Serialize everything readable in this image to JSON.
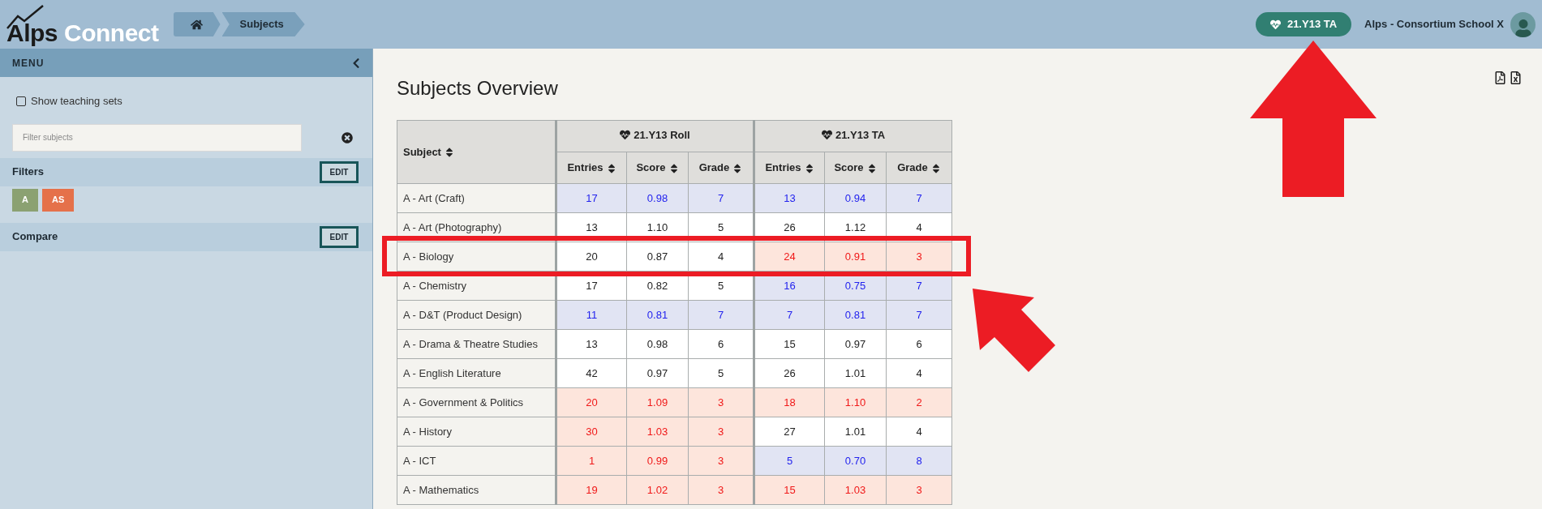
{
  "header": {
    "logo": [
      "Alps",
      "Connect"
    ],
    "breadcrumb": [
      {
        "label": "Subjects"
      }
    ],
    "dataset_badge": "21.Y13 TA",
    "school": "Alps - Consortium School X"
  },
  "sidebar": {
    "title": "MENU",
    "show_teaching_sets": {
      "label": "Show teaching sets",
      "checked": false
    },
    "search": {
      "placeholder": "Filter subjects"
    },
    "sections": [
      {
        "title": "Filters",
        "button": "EDIT",
        "tags": [
          {
            "label": "A",
            "color": "#8ba172"
          },
          {
            "label": "AS",
            "color": "#e5714a"
          }
        ]
      },
      {
        "title": "Compare",
        "button": "EDIT"
      }
    ]
  },
  "main": {
    "title": "Subjects Overview",
    "table": {
      "subject_heading": "Subject",
      "groups": [
        {
          "title": "21.Y13 Roll",
          "columns": [
            "Entries",
            "Score",
            "Grade"
          ]
        },
        {
          "title": "21.Y13 TA",
          "columns": [
            "Entries",
            "Score",
            "Grade"
          ]
        }
      ],
      "rows": [
        {
          "subject": "A - Art (Craft)",
          "sets": [
            {
              "kind": "blue",
              "values": [
                "17",
                "0.98",
                "7"
              ]
            },
            {
              "kind": "blue",
              "values": [
                "13",
                "0.94",
                "7"
              ]
            }
          ]
        },
        {
          "subject": "A - Art (Photography)",
          "sets": [
            {
              "kind": "plain",
              "values": [
                "13",
                "1.10",
                "5"
              ]
            },
            {
              "kind": "plain",
              "values": [
                "26",
                "1.12",
                "4"
              ]
            }
          ]
        },
        {
          "subject": "A - Biology",
          "sets": [
            {
              "kind": "plain",
              "values": [
                "20",
                "0.87",
                "4"
              ]
            },
            {
              "kind": "red",
              "values": [
                "24",
                "0.91",
                "3"
              ]
            }
          ]
        },
        {
          "subject": "A - Chemistry",
          "sets": [
            {
              "kind": "plain",
              "values": [
                "17",
                "0.82",
                "5"
              ]
            },
            {
              "kind": "blue",
              "values": [
                "16",
                "0.75",
                "7"
              ]
            }
          ]
        },
        {
          "subject": "A - D&T (Product Design)",
          "sets": [
            {
              "kind": "blue",
              "values": [
                "11",
                "0.81",
                "7"
              ]
            },
            {
              "kind": "blue",
              "values": [
                "7",
                "0.81",
                "7"
              ]
            }
          ]
        },
        {
          "subject": "A - Drama & Theatre Studies",
          "sets": [
            {
              "kind": "plain",
              "values": [
                "13",
                "0.98",
                "6"
              ]
            },
            {
              "kind": "plain",
              "values": [
                "15",
                "0.97",
                "6"
              ]
            }
          ]
        },
        {
          "subject": "A - English Literature",
          "sets": [
            {
              "kind": "plain",
              "values": [
                "42",
                "0.97",
                "5"
              ]
            },
            {
              "kind": "plain",
              "values": [
                "26",
                "1.01",
                "4"
              ]
            }
          ]
        },
        {
          "subject": "A - Government & Politics",
          "sets": [
            {
              "kind": "red",
              "values": [
                "20",
                "1.09",
                "3"
              ]
            },
            {
              "kind": "red",
              "values": [
                "18",
                "1.10",
                "2"
              ]
            }
          ]
        },
        {
          "subject": "A - History",
          "sets": [
            {
              "kind": "red",
              "values": [
                "30",
                "1.03",
                "3"
              ]
            },
            {
              "kind": "plain",
              "values": [
                "27",
                "1.01",
                "4"
              ]
            }
          ]
        },
        {
          "subject": "A - ICT",
          "sets": [
            {
              "kind": "red",
              "values": [
                "1",
                "0.99",
                "3"
              ]
            },
            {
              "kind": "blue",
              "values": [
                "5",
                "0.70",
                "8"
              ]
            }
          ]
        },
        {
          "subject": "A - Mathematics",
          "sets": [
            {
              "kind": "red",
              "values": [
                "19",
                "1.02",
                "3"
              ]
            },
            {
              "kind": "red",
              "values": [
                "15",
                "1.03",
                "3"
              ]
            }
          ]
        }
      ]
    }
  }
}
